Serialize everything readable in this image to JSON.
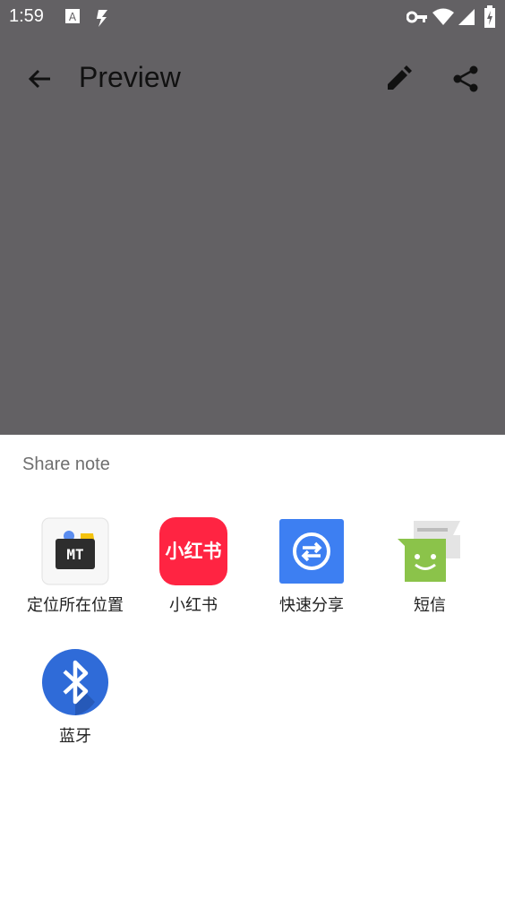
{
  "status_bar": {
    "time": "1:59"
  },
  "app_bar": {
    "title": "Preview"
  },
  "sheet": {
    "title": "Share note",
    "apps": [
      {
        "label": "定位所在位置",
        "icon": "mt-manager-icon"
      },
      {
        "label": "小红书",
        "icon": "xiaohongshu-icon",
        "icon_text": "小红书"
      },
      {
        "label": "快速分享",
        "icon": "quick-share-icon"
      },
      {
        "label": "短信",
        "icon": "messaging-icon"
      },
      {
        "label": "蓝牙",
        "icon": "bluetooth-icon"
      }
    ]
  },
  "colors": {
    "scrim": "#636164",
    "xiaohongshu": "#ff2442",
    "quick_share": "#3d7ff2",
    "messaging": "#8bc34a",
    "bluetooth": "#2f6bd8"
  }
}
